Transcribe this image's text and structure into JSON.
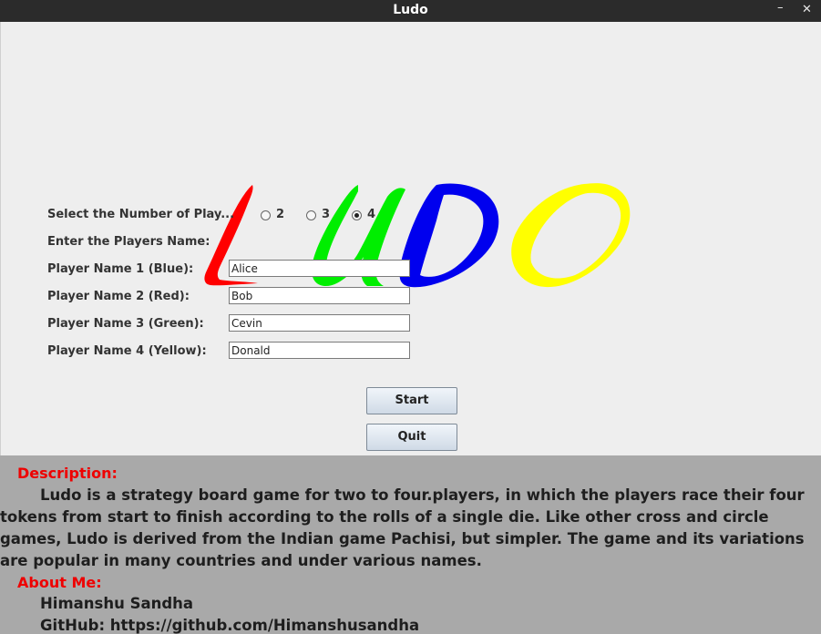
{
  "window": {
    "title": "Ludo",
    "minimize_glyph": "–",
    "close_glyph": "✕"
  },
  "logo": {
    "text": "LUDO",
    "colors": [
      "#ff0000",
      "#00ff00",
      "#0000ff",
      "#ffff00"
    ]
  },
  "form": {
    "players_label": "Select the Number of Play...",
    "player_options": [
      "2",
      "3",
      "4"
    ],
    "selected_players": "4",
    "names_label": "Enter the Players Name:",
    "players": [
      {
        "label": "Player Name 1 (Blue):",
        "value": "Alice"
      },
      {
        "label": "Player Name 2 (Red):",
        "value": "Bob"
      },
      {
        "label": "Player Name 3 (Green):",
        "value": "Cevin"
      },
      {
        "label": "Player Name 4 (Yellow):",
        "value": "Donald"
      }
    ],
    "start_label": "Start",
    "quit_label": "Quit"
  },
  "info": {
    "description_heading": "Description:",
    "description_text": "Ludo is a strategy board game for two to four.players, in which the players race their four tokens from start to finish according to the rolls of a single die. Like other cross and circle games, Ludo is derived from the Indian game Pachisi, but simpler. The game and its variations are popular in many countries and under various names.",
    "about_heading": "About Me:",
    "author": "Himanshu Sandha",
    "github": "GitHub: https://github.com/Himanshusandha"
  }
}
